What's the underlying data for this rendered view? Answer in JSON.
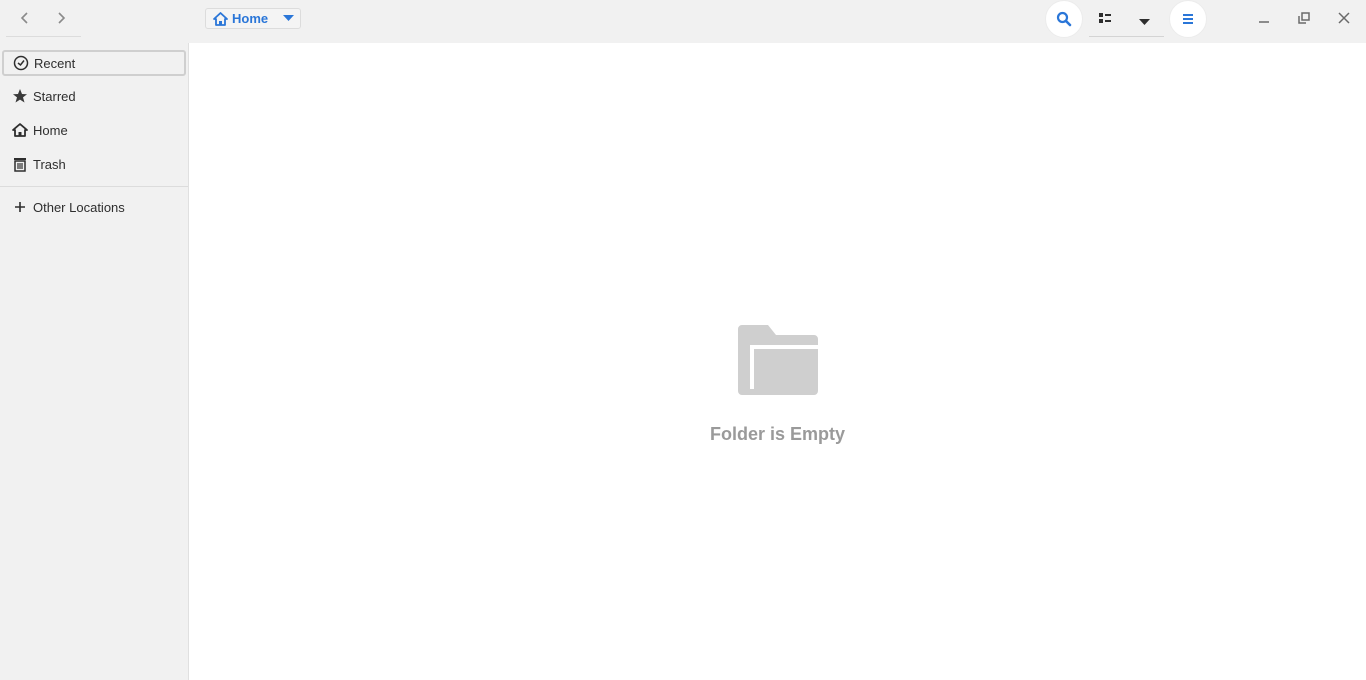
{
  "header": {
    "back_icon": "chevron-left-icon",
    "forward_icon": "chevron-right-icon",
    "path": {
      "icon": "home-icon",
      "label": "Home",
      "dropdown_icon": "triangle-down-icon"
    },
    "search_icon": "search-icon",
    "view_icon": "list-view-icon",
    "view_dropdown_icon": "triangle-down-icon",
    "menu_icon": "hamburger-icon",
    "window": {
      "minimize": "minimize-icon",
      "maximize": "maximize-icon",
      "close": "close-icon"
    }
  },
  "sidebar": {
    "items": [
      {
        "label": "Recent",
        "icon": "clock-icon",
        "active": true
      },
      {
        "label": "Starred",
        "icon": "star-icon"
      },
      {
        "label": "Home",
        "icon": "home-icon"
      },
      {
        "label": "Trash",
        "icon": "trash-icon"
      }
    ],
    "other": {
      "label": "Other Locations",
      "icon": "plus-icon"
    }
  },
  "main": {
    "empty_icon": "folder-icon",
    "empty_message": "Folder is Empty"
  },
  "colors": {
    "accent": "#2a76d8",
    "empty_gray": "#cfcfcf"
  }
}
